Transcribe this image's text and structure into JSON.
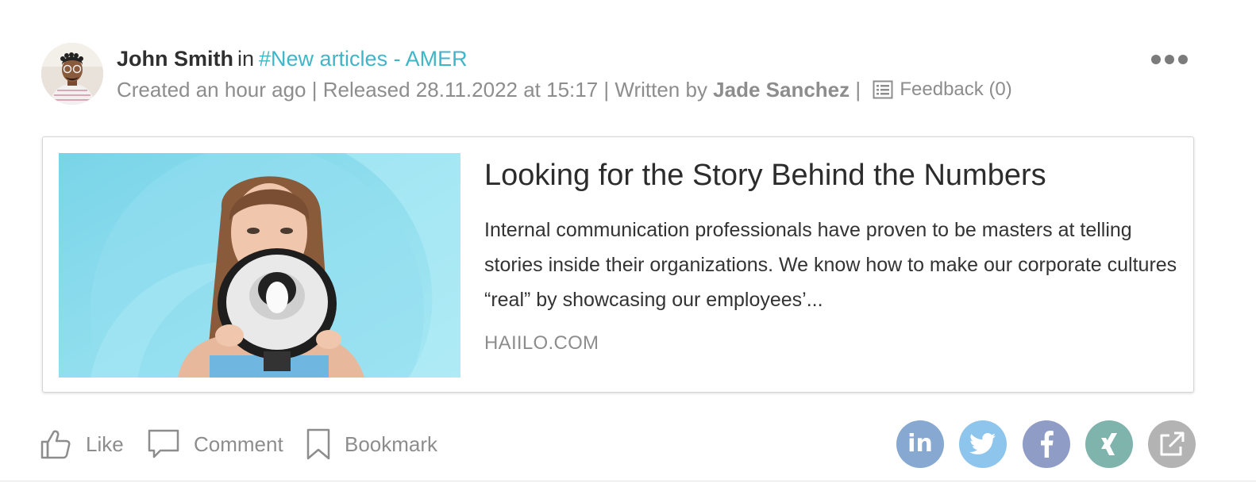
{
  "post": {
    "author": "John Smith",
    "in_word": "in",
    "channel": "#New articles - AMER",
    "meta": {
      "created": "Created an hour ago",
      "sep1": " | ",
      "released": "Released 28.11.2022 at 15:17",
      "sep2": " | ",
      "written_by": "Written by ",
      "writer": "Jade Sanchez",
      "sep3": " |",
      "feedback": "Feedback (0)"
    },
    "more_icon": "more-horizontal-icon"
  },
  "card": {
    "title": "Looking for the Story Behind the Numbers",
    "description": "Internal communication professionals have proven to be masters at telling stories inside their organizations. We know how to make our corporate cultures “real” by showcasing our employees’...",
    "domain": "HAIILO.COM"
  },
  "actions": {
    "like": "Like",
    "comment": "Comment",
    "bookmark": "Bookmark"
  },
  "share": {
    "linkedin_text": "in",
    "icons": [
      "linkedin-icon",
      "twitter-icon",
      "facebook-icon",
      "xing-icon",
      "external-share-icon"
    ]
  },
  "colors": {
    "channel": "#3fb6c8",
    "meta_gray": "#8d8d8d",
    "linkedin": "#86a8d1",
    "twitter": "#8dc5ec",
    "facebook": "#8e9cc6",
    "xing": "#7fb4ac",
    "external": "#b3b3b3"
  }
}
